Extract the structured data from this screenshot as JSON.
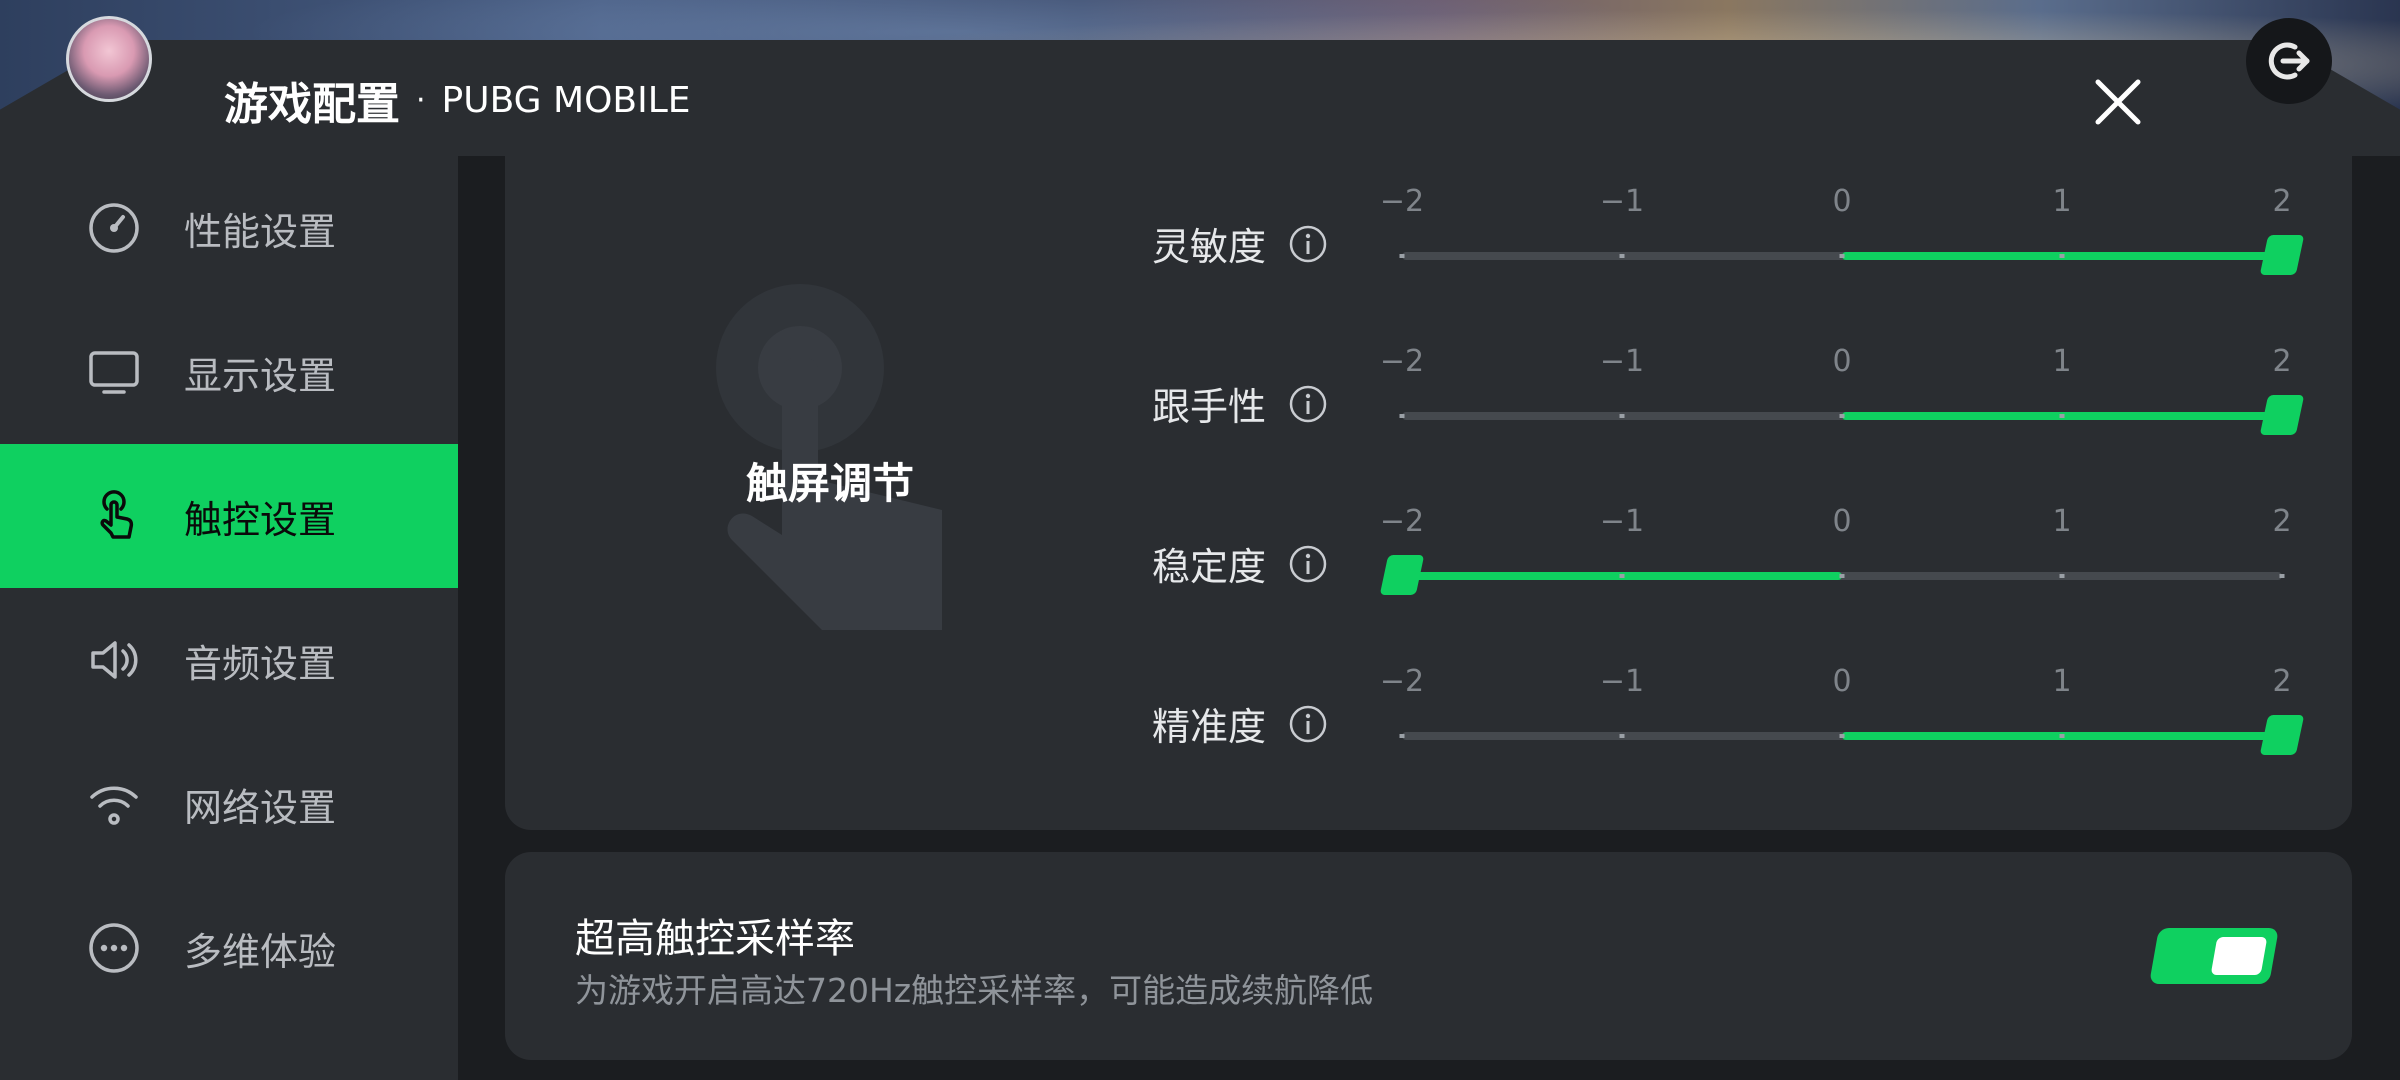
{
  "header": {
    "title": "游戏配置",
    "separator": "·",
    "game": "PUBG MOBILE"
  },
  "sidebar": {
    "items": [
      {
        "label": "性能设置",
        "icon": "speedometer-icon",
        "active": false
      },
      {
        "label": "显示设置",
        "icon": "monitor-icon",
        "active": false
      },
      {
        "label": "触控设置",
        "icon": "touch-hand-icon",
        "active": true
      },
      {
        "label": "音频设置",
        "icon": "speaker-icon",
        "active": false
      },
      {
        "label": "网络设置",
        "icon": "wifi-icon",
        "active": false
      },
      {
        "label": "多维体验",
        "icon": "more-dots-icon",
        "active": false
      }
    ]
  },
  "touch_section": {
    "title": "触屏调节",
    "tick_labels": [
      "−2",
      "−1",
      "0",
      "1",
      "2"
    ],
    "sliders": [
      {
        "label": "灵敏度",
        "value": 2
      },
      {
        "label": "跟手性",
        "value": 2
      },
      {
        "label": "稳定度",
        "value": -2
      },
      {
        "label": "精准度",
        "value": 2
      }
    ]
  },
  "sampling": {
    "title": "超高触控采样率",
    "description": "为游戏开启高达720Hz触控采样率，可能造成续航降低",
    "enabled": true
  },
  "colors": {
    "accent": "#0fd060",
    "panel": "#2a2d31",
    "background": "#1b1d20"
  }
}
